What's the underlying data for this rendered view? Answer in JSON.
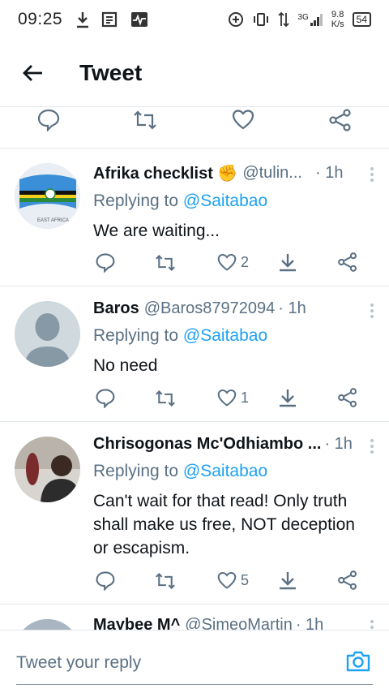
{
  "status_bar": {
    "time": "09:25",
    "network": "3G",
    "speed_value": "9.8",
    "speed_unit": "K/s",
    "battery": "54"
  },
  "header": {
    "title": "Tweet"
  },
  "tweets": [
    {
      "name": "Afrika checklist ✊",
      "handle": "@tulin...",
      "time": "· 1h",
      "replying_label": "Replying to ",
      "replying_to": "@Saitabao",
      "text": "We are waiting...",
      "likes": "2"
    },
    {
      "name": "Baros",
      "handle": "@Baros87972094",
      "time": "· 1h",
      "replying_label": "Replying to ",
      "replying_to": "@Saitabao",
      "text": "No need",
      "likes": "1"
    },
    {
      "name": "Chrisogonas Mc'Odhiambo ...",
      "handle": "",
      "time": "· 1h",
      "replying_label": "Replying to ",
      "replying_to": "@Saitabao",
      "text": "Can't wait for that read! Only truth shall make us free, NOT deception or escapism.",
      "likes": "5"
    },
    {
      "name": "Maybee M^",
      "handle": "@SimeoMartin",
      "time": "· 1h"
    }
  ],
  "reply_bar": {
    "placeholder": "Tweet your reply"
  },
  "colors": {
    "accent": "#1da1f2",
    "muted": "#5b7083",
    "text": "#0f1419",
    "divider": "#e1e8ed"
  }
}
